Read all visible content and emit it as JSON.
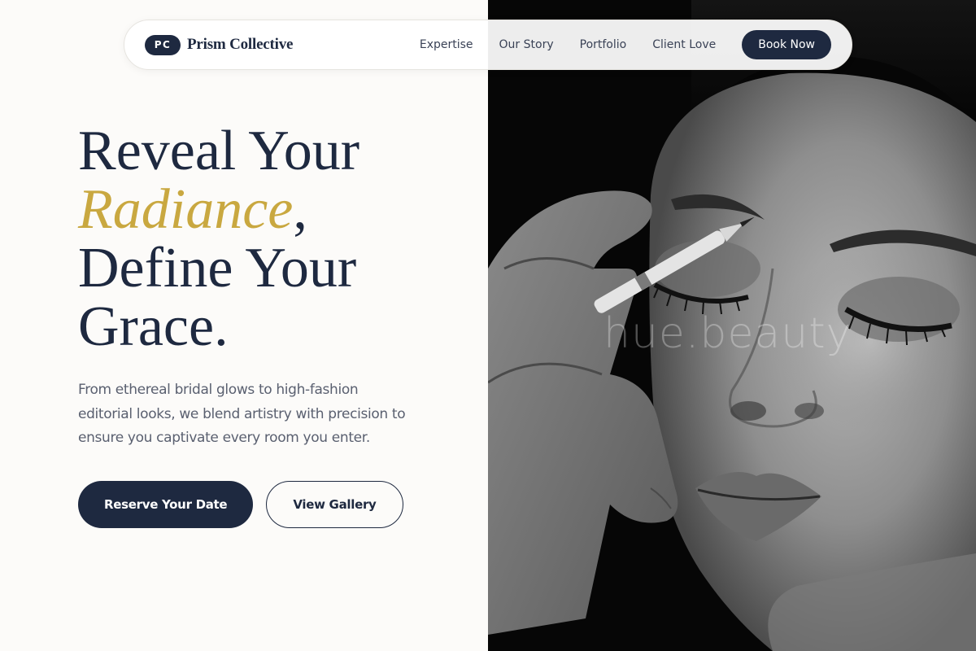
{
  "brand": {
    "badge": "PC",
    "name": "Prism Collective"
  },
  "nav": {
    "links": [
      "Expertise",
      "Our Story",
      "Portfolio",
      "Client Love"
    ],
    "cta": "Book Now"
  },
  "hero": {
    "title_line1": "Reveal Your",
    "title_accent": "Radiance",
    "title_accent_punct": ",",
    "title_line3": "Define Your",
    "title_line4": "Grace.",
    "description": "From ethereal bridal glows to high-fashion editorial looks, we blend artistry with precision to ensure you captivate every room you enter.",
    "primary_button": "Reserve Your Date",
    "secondary_button": "View Gallery"
  },
  "photo": {
    "watermark": "hue.beauty"
  },
  "colors": {
    "navy": "#1e2940",
    "gold_accent": "#c9a840",
    "background": "#fcfbf9",
    "body_text": "#5a6070"
  }
}
